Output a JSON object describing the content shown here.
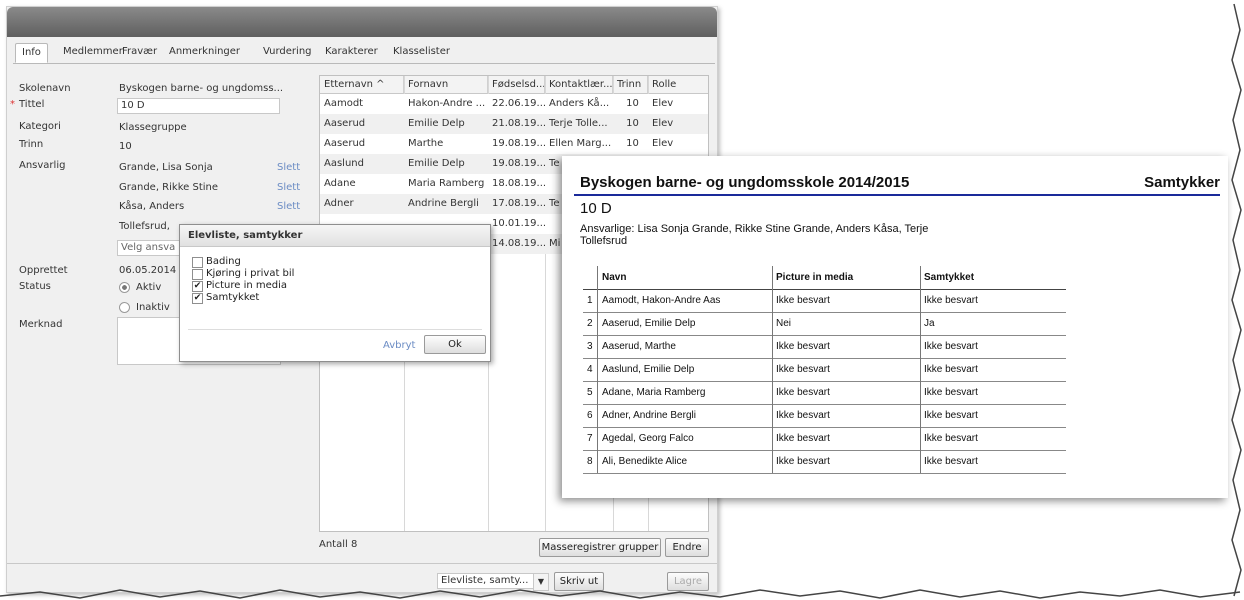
{
  "app": {
    "tabs": [
      "Info",
      "Medlemmer",
      "Fravær",
      "Anmerkninger",
      "Vurdering",
      "Karakterer",
      "Klasselister"
    ],
    "active_tab": "Info",
    "form": {
      "skolenavn_label": "Skolenavn",
      "skolenavn_value": "Byskogen barne- og ungdomss...",
      "tittel_label": "Tittel",
      "tittel_required": "*",
      "tittel_value": "10 D",
      "kategori_label": "Kategori",
      "kategori_value": "Klassegruppe",
      "trinn_label": "Trinn",
      "trinn_value": "10",
      "ansvarlig_label": "Ansvarlig",
      "ansvarlig": [
        {
          "name": "Grande, Lisa Sonja",
          "action": "Slett"
        },
        {
          "name": "Grande, Rikke Stine",
          "action": "Slett"
        },
        {
          "name": "Kåsa, Anders",
          "action": "Slett"
        },
        {
          "name": "Tollefsrud,",
          "action": ""
        }
      ],
      "velg_placeholder": "Velg ansva",
      "opprettet_label": "Opprettet",
      "opprettet_value": "06.05.2014",
      "status_label": "Status",
      "status_aktiv": "Aktiv",
      "status_inaktiv": "Inaktiv",
      "merknad_label": "Merknad"
    },
    "grid": {
      "columns": [
        "Etternavn ^",
        "Fornavn",
        "Fødselsd...",
        "Kontaktlær...",
        "Trinn",
        "Rolle"
      ],
      "rows": [
        [
          "Aamodt",
          "Hakon-Andre ...",
          "22.06.19...",
          "Anders Kå...",
          "10",
          "Elev"
        ],
        [
          "Aaserud",
          "Emilie Delp",
          "21.08.19...",
          "Terje Tolle...",
          "10",
          "Elev"
        ],
        [
          "Aaserud",
          "Marthe",
          "19.08.19...",
          "Ellen Marg...",
          "10",
          "Elev"
        ],
        [
          "Aaslund",
          "Emilie Delp",
          "19.08.19...",
          "Te",
          "",
          ""
        ],
        [
          "Adane",
          "Maria Ramberg",
          "18.08.19...",
          "",
          "",
          ""
        ],
        [
          "Adner",
          "Andrine Bergli",
          "17.08.19...",
          "Te",
          "",
          ""
        ],
        [
          "",
          "",
          "10.01.19...",
          "",
          "",
          ""
        ],
        [
          "",
          "",
          "14.08.19...",
          "Mi",
          "",
          ""
        ]
      ],
      "antall": "Antall 8",
      "btn_masse": "Masseregistrer grupper",
      "btn_endre": "Endre"
    },
    "footer": {
      "select_value": "Elevliste, samty...",
      "btn_skrivut": "Skriv ut",
      "btn_lagre": "Lagre"
    },
    "dialog": {
      "title": "Elevliste, samtykker",
      "options": [
        {
          "label": "Bading",
          "checked": false
        },
        {
          "label": "Kjøring i privat bil",
          "checked": false
        },
        {
          "label": "Picture in media",
          "checked": true
        },
        {
          "label": "Samtykket",
          "checked": true
        }
      ],
      "cancel": "Avbryt",
      "ok": "Ok"
    }
  },
  "report": {
    "title": "Byskogen barne- og ungdomsskole 2014/2015",
    "right_title": "Samtykker",
    "class_name": "10 D",
    "responsible": "Ansvarlige: Lisa Sonja Grande, Rikke Stine Grande, Anders Kåsa, Terje Tollefsrud",
    "headers": [
      "Navn",
      "Picture in media",
      "Samtykket"
    ],
    "rows": [
      {
        "n": "1",
        "navn": "Aamodt, Hakon-Andre Aas",
        "picture": "Ikke besvart",
        "samtykket": "Ikke besvart"
      },
      {
        "n": "2",
        "navn": "Aaserud, Emilie Delp",
        "picture": "Nei",
        "samtykket": "Ja"
      },
      {
        "n": "3",
        "navn": "Aaserud, Marthe",
        "picture": "Ikke besvart",
        "samtykket": "Ikke besvart"
      },
      {
        "n": "4",
        "navn": "Aaslund, Emilie Delp",
        "picture": "Ikke besvart",
        "samtykket": "Ikke besvart"
      },
      {
        "n": "5",
        "navn": "Adane, Maria Ramberg",
        "picture": "Ikke besvart",
        "samtykket": "Ikke besvart"
      },
      {
        "n": "6",
        "navn": "Adner, Andrine Bergli",
        "picture": "Ikke besvart",
        "samtykket": "Ikke besvart"
      },
      {
        "n": "7",
        "navn": "Agedal, Georg Falco",
        "picture": "Ikke besvart",
        "samtykket": "Ikke besvart"
      },
      {
        "n": "8",
        "navn": "Ali, Benedikte Alice",
        "picture": "Ikke besvart",
        "samtykket": "Ikke besvart"
      }
    ]
  }
}
